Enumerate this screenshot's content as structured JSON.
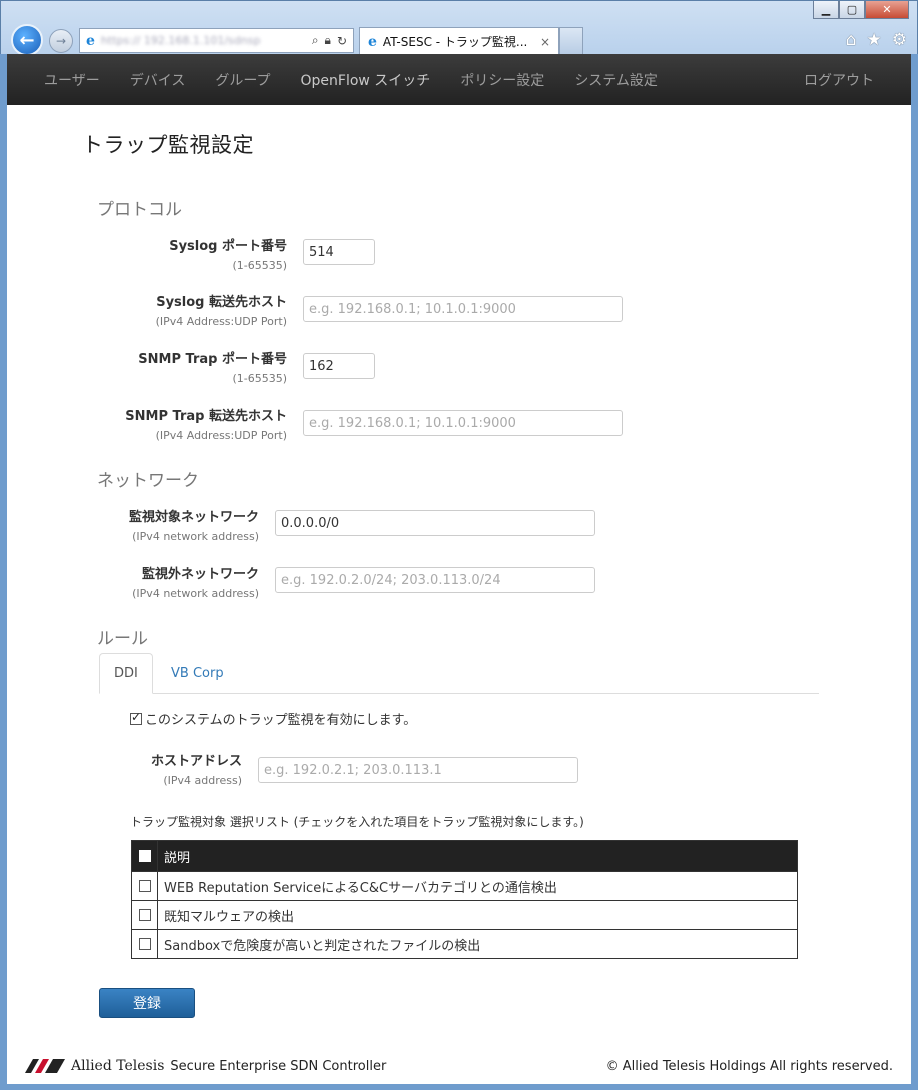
{
  "browser": {
    "url": "https://  192.168.1.101/sdnsp",
    "tab_title": "AT-SESC - トラップ監視...",
    "tab_close": "×",
    "window_buttons": [
      "minimize",
      "maximize",
      "close"
    ],
    "toolbar_icons": [
      "home-icon",
      "star-icon",
      "gear-icon"
    ]
  },
  "nav": {
    "items": [
      "ユーザー",
      "デバイス",
      "グループ",
      "OpenFlow スイッチ",
      "ポリシー設定",
      "システム設定"
    ],
    "logout": "ログアウト"
  },
  "page_title": "トラップ監視設定",
  "protocol": {
    "heading": "プロトコル",
    "syslog_port": {
      "label": "Syslog ポート番号",
      "hint": "(1-65535)",
      "value": "514"
    },
    "syslog_host": {
      "label": "Syslog 転送先ホスト",
      "hint": "(IPv4 Address:UDP Port)",
      "placeholder": "e.g. 192.168.0.1; 10.1.0.1:9000"
    },
    "snmp_port": {
      "label": "SNMP Trap ポート番号",
      "hint": "(1-65535)",
      "value": "162"
    },
    "snmp_host": {
      "label": "SNMP Trap 転送先ホスト",
      "hint": "(IPv4 Address:UDP Port)",
      "placeholder": "e.g. 192.168.0.1; 10.1.0.1:9000"
    }
  },
  "network": {
    "heading": "ネットワーク",
    "monitored": {
      "label": "監視対象ネットワーク",
      "hint": "(IPv4 network address)",
      "value": "0.0.0.0/0"
    },
    "excluded": {
      "label": "監視外ネットワーク",
      "hint": "(IPv4 network address)",
      "placeholder": "e.g. 192.0.2.0/24; 203.0.113.0/24"
    }
  },
  "rules": {
    "heading": "ルール",
    "tabs": [
      "DDI",
      "VB Corp"
    ],
    "active_tab": "DDI",
    "enable_label": "このシステムのトラップ監視を有効にします。",
    "enable_checked": true,
    "host": {
      "label": "ホストアドレス",
      "hint": "(IPv4 address)",
      "placeholder": "e.g. 192.0.2.1; 203.0.113.1"
    },
    "list_title": "トラップ監視対象 選択リスト (チェックを入れた項目をトラップ監視対象にします。)",
    "table_header": "説明",
    "rows": [
      "WEB Reputation ServiceによるC&Cサーバカテゴリとの通信検出",
      "既知マルウェアの検出",
      "Sandboxで危険度が高いと判定されたファイルの検出"
    ]
  },
  "submit_label": "登録",
  "footer": {
    "brand": "Allied Telesis",
    "product": "Secure Enterprise SDN Controller",
    "copyright": "© Allied Telesis Holdings All rights reserved."
  },
  "colors": {
    "navbar": "#222222",
    "primary_button": "#286090",
    "link": "#337ab7"
  }
}
